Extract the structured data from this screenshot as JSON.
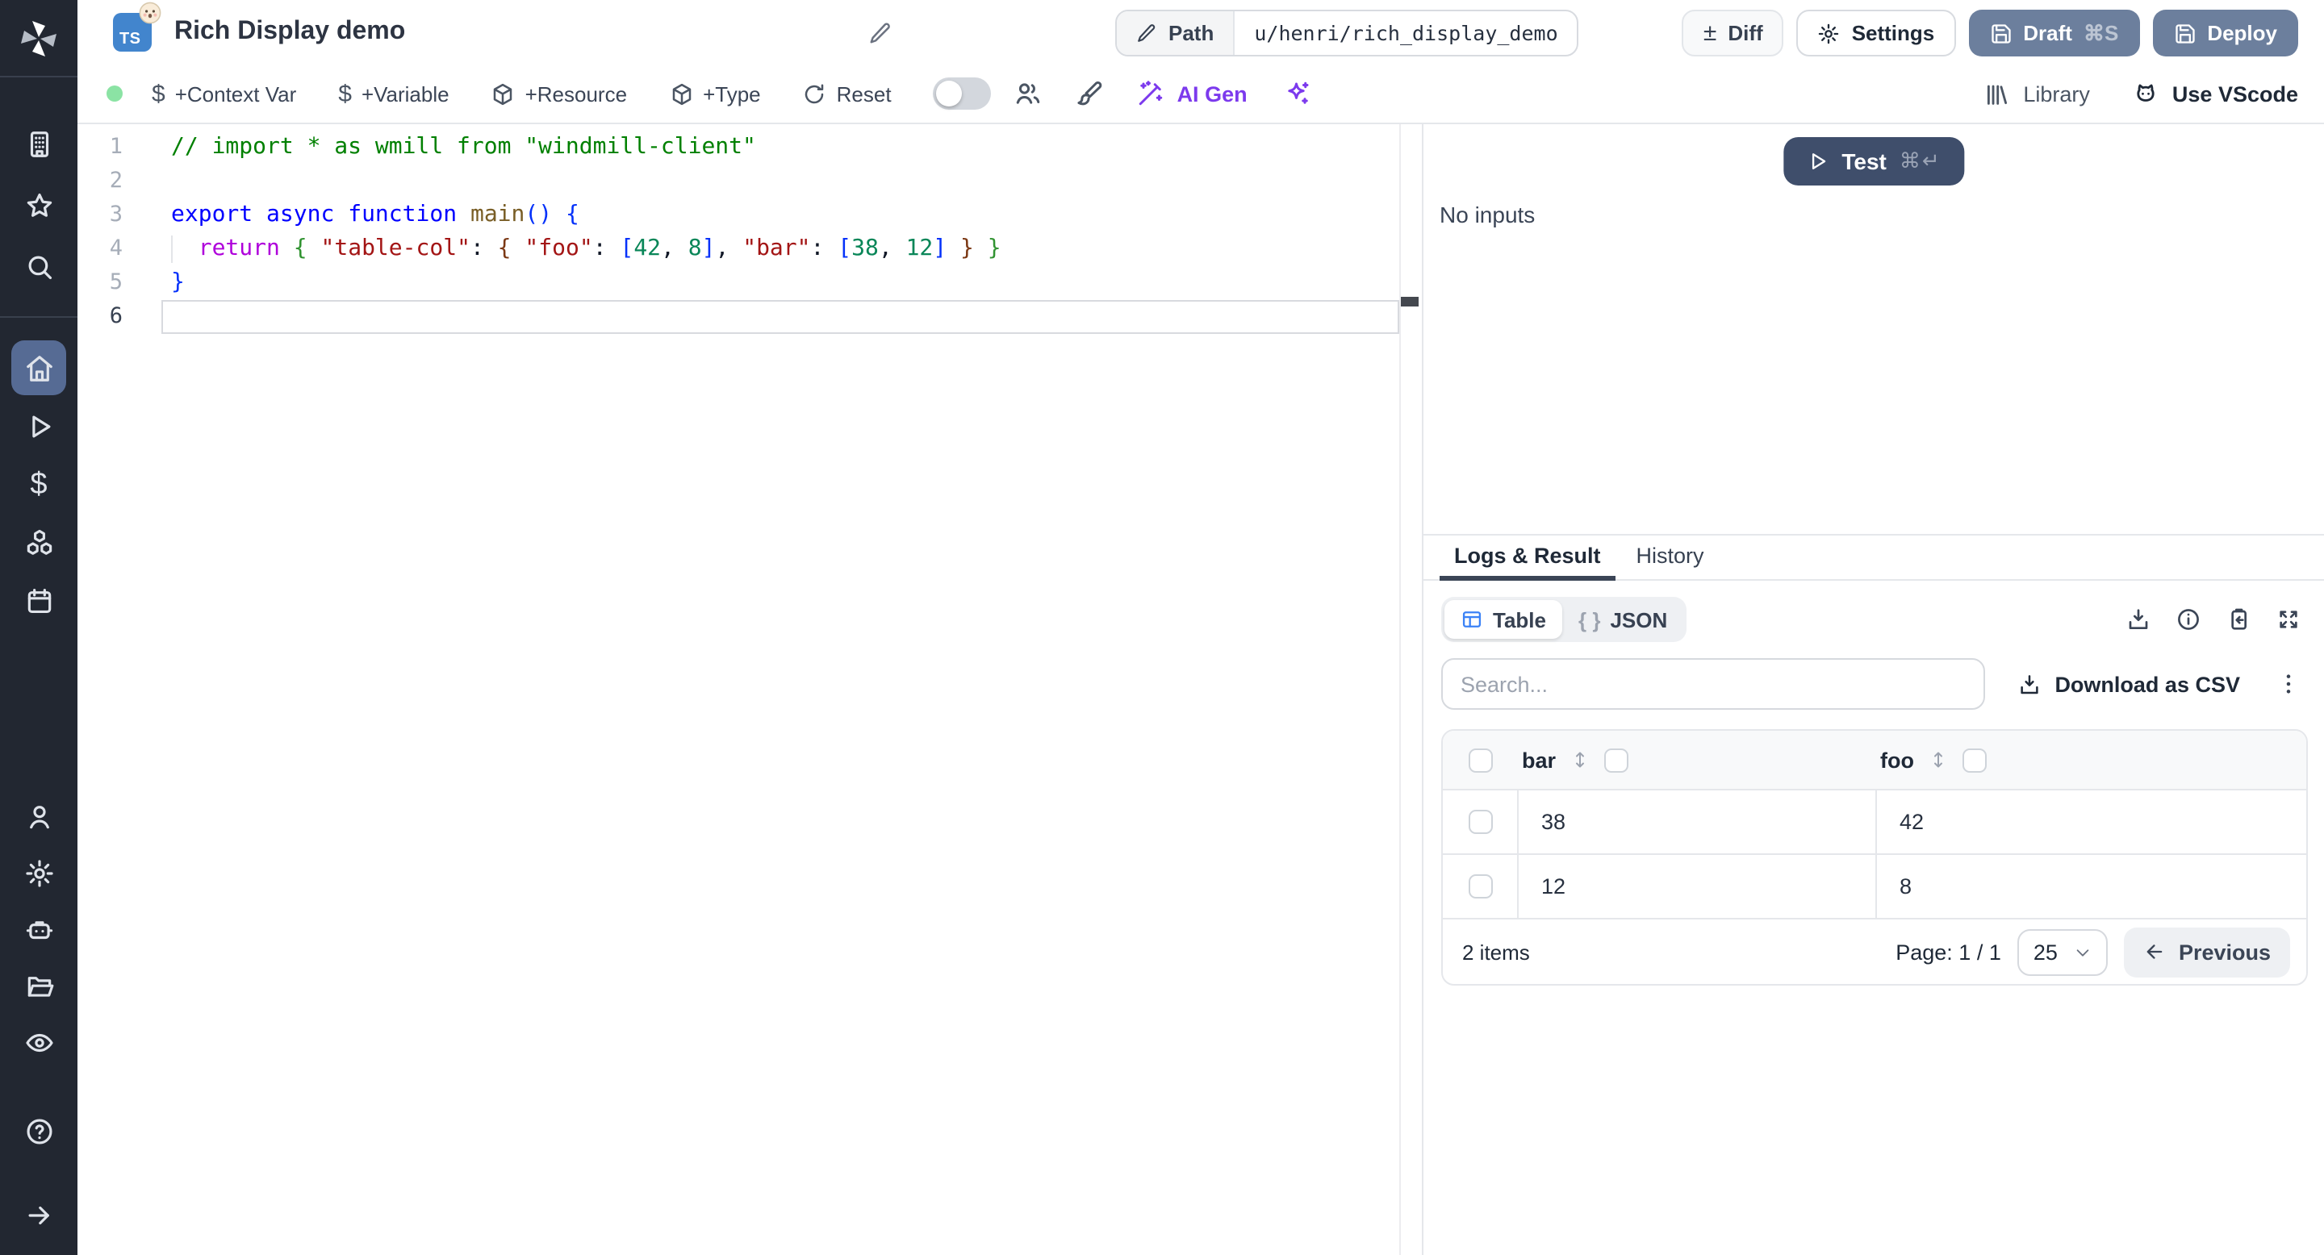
{
  "colors": {
    "sidebar_bg": "#222731",
    "sidebar_active_bg": "#566b94",
    "primary_button": "#6c7f9d",
    "test_button": "#3f4e6b",
    "accent_purple": "#7c3aed",
    "status_green": "#8be3a4",
    "table_icon_blue": "#3b82f6",
    "ts_badge_blue": "#4285cd",
    "border": "#e5e7eb"
  },
  "sidebar": {
    "icons": [
      "windmill-logo",
      "building",
      "star",
      "search",
      "home",
      "play",
      "dollar",
      "cubes",
      "calendar",
      "user",
      "settings",
      "robot",
      "folder",
      "eye",
      "help",
      "collapse-arrow"
    ],
    "active_item": "home"
  },
  "header": {
    "lang_badge": "TS",
    "title": "Rich Display demo",
    "path_label": "Path",
    "path_value": "u/henri/rich_display_demo",
    "diff_icon": "±",
    "diff_label": "Diff",
    "settings_icon": "⚙",
    "settings_label": "Settings",
    "draft_label": "Draft",
    "draft_shortcut": "⌘S",
    "deploy_label": "Deploy"
  },
  "toolbar": {
    "context_var_label": "+Context Var",
    "variable_label": "+Variable",
    "resource_label": "+Resource",
    "type_label": "+Type",
    "reset_label": "Reset",
    "ai_gen_label": "AI Gen",
    "library_label": "Library",
    "vscode_label": "Use VScode"
  },
  "editor": {
    "current_line": 6,
    "lines": [
      {
        "tokens": [
          [
            "comment",
            "// import * as wmill from \"windmill-client\""
          ]
        ]
      },
      {
        "tokens": []
      },
      {
        "tokens": [
          [
            "kw",
            "export"
          ],
          [
            "plain",
            " "
          ],
          [
            "kw",
            "async"
          ],
          [
            "plain",
            " "
          ],
          [
            "kw",
            "function"
          ],
          [
            "plain",
            " "
          ],
          [
            "fn",
            "main"
          ],
          [
            "b1",
            "()"
          ],
          [
            "plain",
            " "
          ],
          [
            "b1",
            "{"
          ]
        ]
      },
      {
        "guide": true,
        "tokens": [
          [
            "plain",
            "  "
          ],
          [
            "ctrl",
            "return"
          ],
          [
            "plain",
            " "
          ],
          [
            "b2",
            "{"
          ],
          [
            "plain",
            " "
          ],
          [
            "str",
            "\"table-col\""
          ],
          [
            "plain",
            ": "
          ],
          [
            "b3",
            "{"
          ],
          [
            "plain",
            " "
          ],
          [
            "str",
            "\"foo\""
          ],
          [
            "plain",
            ": "
          ],
          [
            "b1",
            "["
          ],
          [
            "num",
            "42"
          ],
          [
            "plain",
            ", "
          ],
          [
            "num",
            "8"
          ],
          [
            "b1",
            "]"
          ],
          [
            "plain",
            ", "
          ],
          [
            "str",
            "\"bar\""
          ],
          [
            "plain",
            ": "
          ],
          [
            "b1",
            "["
          ],
          [
            "num",
            "38"
          ],
          [
            "plain",
            ", "
          ],
          [
            "num",
            "12"
          ],
          [
            "b1",
            "]"
          ],
          [
            "plain",
            " "
          ],
          [
            "b3",
            "}"
          ],
          [
            "plain",
            " "
          ],
          [
            "b2",
            "}"
          ]
        ]
      },
      {
        "tokens": [
          [
            "b1",
            "}"
          ]
        ]
      },
      {
        "tokens": []
      }
    ]
  },
  "run": {
    "test_label": "Test",
    "test_shortcut": "⌘↵",
    "no_inputs": "No inputs"
  },
  "result_panel": {
    "tabs": [
      {
        "label": "Logs & Result",
        "active": true
      },
      {
        "label": "History",
        "active": false
      }
    ],
    "view_toggle": [
      {
        "label": "Table",
        "active": true
      },
      {
        "label": "JSON",
        "active": false
      }
    ],
    "json_braces": "{ }",
    "search_placeholder": "Search...",
    "download_csv_label": "Download as CSV",
    "table": {
      "columns": [
        "bar",
        "foo"
      ],
      "rows": [
        [
          "38",
          "42"
        ],
        [
          "12",
          "8"
        ]
      ],
      "items_label": "2 items",
      "page_label": "Page: 1 / 1",
      "page_size": "25",
      "previous_label": "Previous"
    }
  }
}
